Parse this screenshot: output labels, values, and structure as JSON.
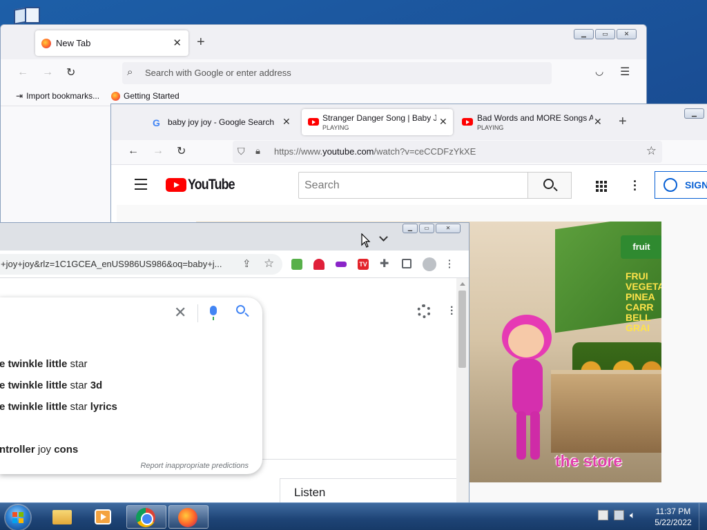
{
  "firefox_back": {
    "tab_title": "New Tab",
    "address_placeholder": "Search with Google or enter address",
    "bookmarks": [
      "Import bookmarks...",
      "Getting Started"
    ]
  },
  "firefox_youtube": {
    "tabs": [
      {
        "title": "baby joy joy - Google Search",
        "status": ""
      },
      {
        "title": "Stranger Danger Song | Baby Jo",
        "status": "PLAYING"
      },
      {
        "title": "Bad Words and MORE Songs Al",
        "status": "PLAYING"
      }
    ],
    "url_prefix": "https://www.",
    "url_domain": "youtube.com",
    "url_path": "/watch?v=ceCCDFzYkXE",
    "youtube": {
      "logo_text": "YouTube",
      "search_placeholder": "Search",
      "sign_in_label": "SIGN"
    },
    "video": {
      "caption": "the store",
      "store_sign": "fruit",
      "shelf_text_1": "FRUI",
      "shelf_text_2": "VEGETAB",
      "shelf_text_3": "PINEA",
      "shelf_text_4": "CARR",
      "shelf_text_5": "BELL",
      "shelf_text_6": "GRAI"
    }
  },
  "chrome": {
    "url": "+joy+joy&rlz=1C1GCEA_enUS986US986&oq=baby+j...",
    "suggestions": [
      {
        "bold": "e twinkle little",
        "rest": " star",
        "tail": ""
      },
      {
        "bold": "e twinkle little",
        "rest": " star ",
        "tail": "3d"
      },
      {
        "bold": "e twinkle little",
        "rest": " star ",
        "tail": "lyrics"
      },
      {
        "bold": "ntroller",
        "rest": " joy ",
        "tail": "cons"
      }
    ],
    "report_text": "Report inappropriate predictions",
    "listen_label": "Listen"
  },
  "taskbar": {
    "time": "11:37 PM",
    "date": "5/22/2022"
  },
  "colors": {
    "youtube_red": "#ff0000",
    "google_blue": "#4285f4",
    "signin_blue": "#065fd4",
    "caption_pink": "#e03ea9"
  }
}
